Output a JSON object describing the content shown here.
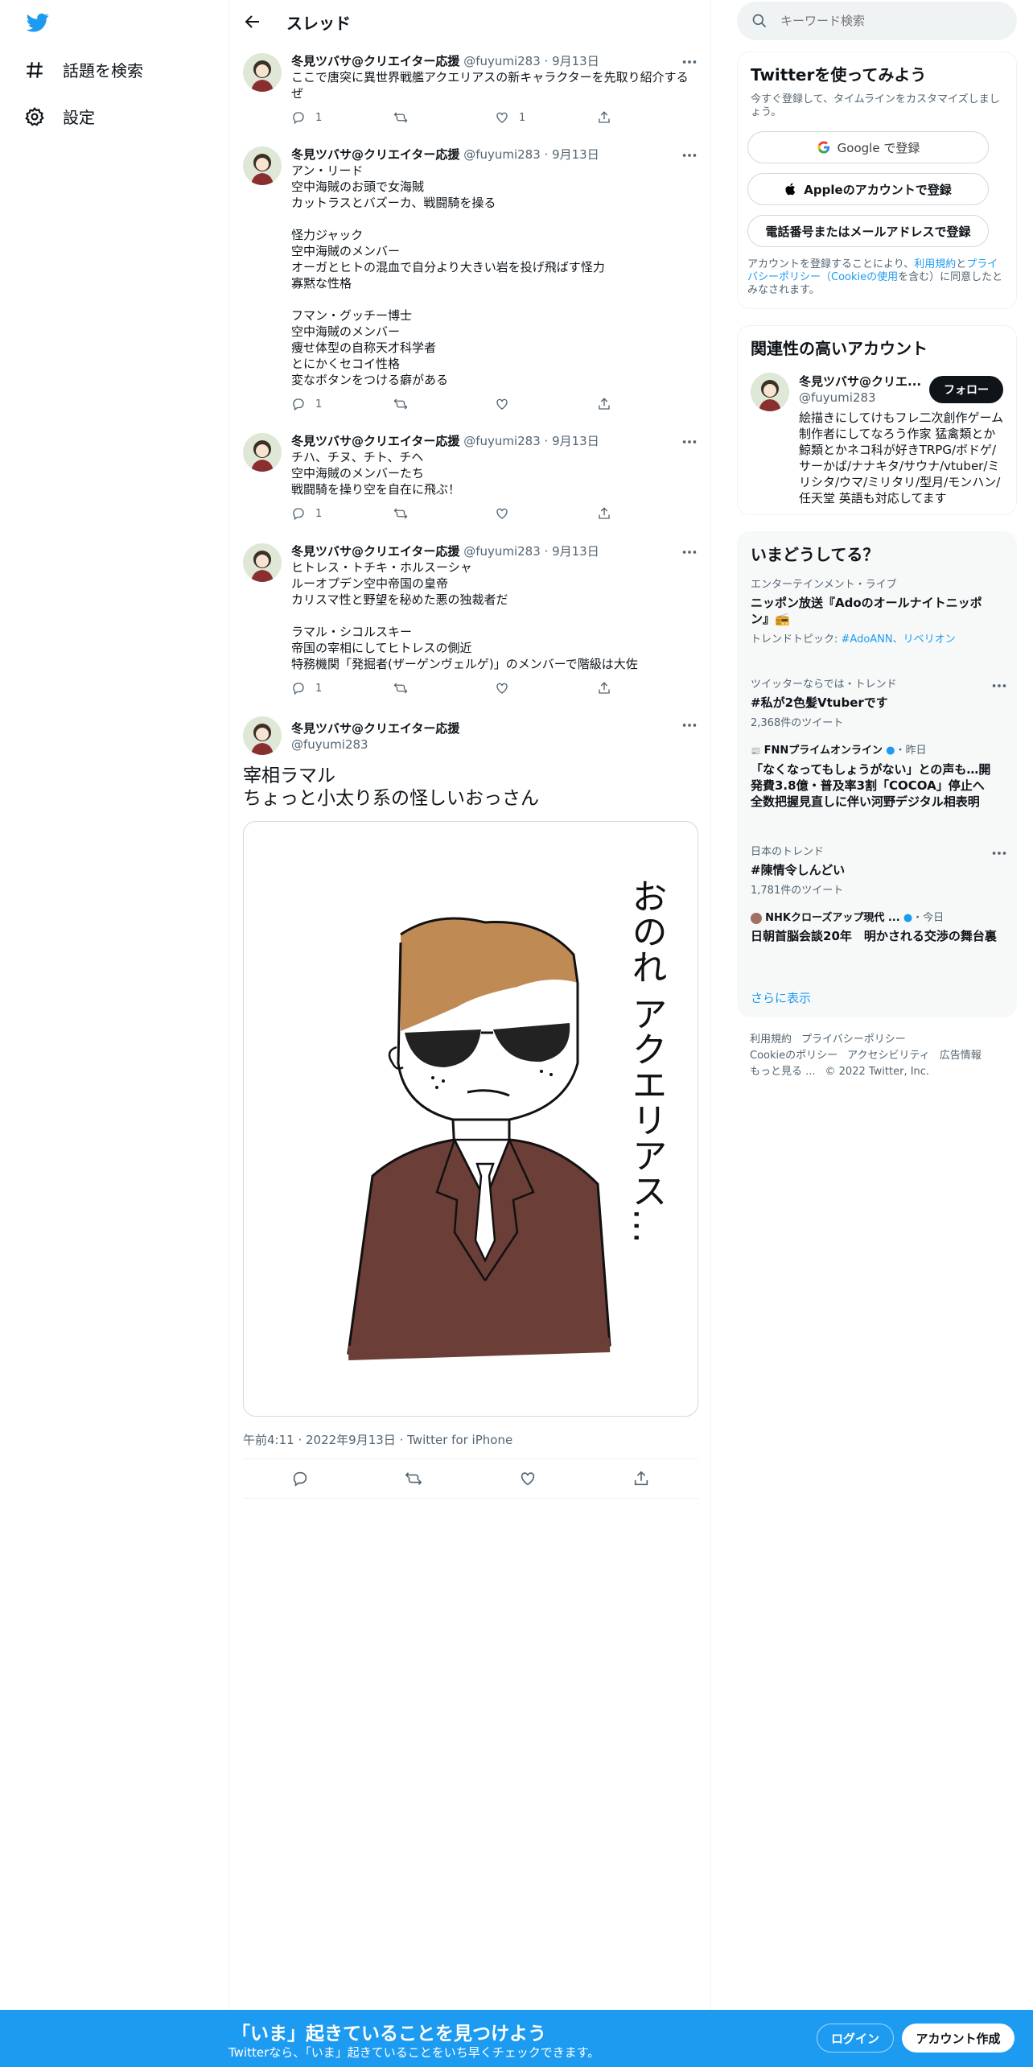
{
  "nav": {
    "explore_label": "話題を検索",
    "settings_label": "設定"
  },
  "header": {
    "title": "スレッド"
  },
  "search": {
    "placeholder": "キーワード検索"
  },
  "author": {
    "name": "冬見ツバサ@クリエイター応援",
    "handle": "@fuyumi283",
    "date": "9月13日"
  },
  "tweets": [
    {
      "text": "ここで唐突に異世界戦艦アクエリアスの新キャラクターを先取り紹介するぜ",
      "replies": "1",
      "retweets": "",
      "likes": "1"
    },
    {
      "text": "アン・リード\n空中海賊のお頭で女海賊\nカットラスとバズーカ、戦闘騎を操る\n\n怪力ジャック\n空中海賊のメンバー\nオーガとヒトの混血で自分より大きい岩を投げ飛ばす怪力\n寡黙な性格\n\nフマン・グッチー博士\n空中海賊のメンバー\n痩せ体型の自称天才科学者\nとにかくセコイ性格\n変なボタンをつける癖がある",
      "replies": "1",
      "retweets": "",
      "likes": ""
    },
    {
      "text": "チハ、チヌ、チト、チヘ\n空中海賊のメンバーたち\n戦闘騎を操り空を自在に飛ぶ！",
      "replies": "1",
      "retweets": "",
      "likes": ""
    },
    {
      "text": "ヒトレス・トチキ・ホルスーシャ\nルーオプデン空中帝国の皇帝\nカリスマ性と野望を秘めた悪の独裁者だ\n\nラマル・シコルスキー\n帝国の宰相にしてヒトレスの側近\n特務機関「発掘者(ザーゲンヴェルゲ)」のメンバーで階級は大佐",
      "replies": "1",
      "retweets": "",
      "likes": ""
    }
  ],
  "focus_tweet": {
    "text": "宰相ラマル\nちょっと小太り系の怪しいおっさん",
    "image_caption": "おのれ アクエリアス…",
    "time": "午前4:11",
    "date": "2022年9月13日",
    "source": "Twitter for iPhone"
  },
  "signup_card": {
    "title": "Twitterを使ってみよう",
    "subtitle": "今すぐ登録して、タイムラインをカスタマイズしましょう。",
    "google_label": "Google で登録",
    "apple_label": "Appleのアカウントで登録",
    "phone_label": "電話番号またはメールアドレスで登録",
    "terms_pre": "アカウントを登録することにより、",
    "terms_link1": "利用規約",
    "terms_and": "と",
    "terms_link2": "プライバシーポリシー（Cookieの使用",
    "terms_post": "を含む）に同意したとみなされます。"
  },
  "related": {
    "title": "関連性の高いアカウント",
    "name": "冬見ツバサ@クリエ...",
    "handle": "@fuyumi283",
    "follow_label": "フォロー",
    "bio": "絵描きにしてけもフレ二次創作ゲーム制作者にしてなろう作家 猛禽類とか鯨類とかネコ科が好きTRPG/ボドゲ/サーかば/ナナキタ/サウナ/vtuber/ミリシタ/ウマ/ミリタリ/型月/モンハン/任天堂 英語も対応してます"
  },
  "trends": {
    "title": "いまどうしてる？",
    "items": [
      {
        "category": "エンターテインメント・ライブ",
        "title": "ニッポン放送『Adoのオールナイトニッポン』📻",
        "sub_pre": "トレンドトピック: ",
        "sub_link": "#AdoANN、リベリオン"
      },
      {
        "category": "ツイッターならでは・トレンド",
        "title": "#私が2色髪Vtuberです",
        "sub": "2,368件のツイート"
      },
      {
        "category": "FNNプライムオンライン",
        "time": "・昨日",
        "title": "「なくなってもしょうがない」との声も…開発費3.8億・普及率3割「COCOA」停止へ 全数把握見直しに伴い河野デジタル相表明"
      },
      {
        "category": "日本のトレンド",
        "title": "#陳情令しんどい",
        "sub": "1,781件のツイート"
      },
      {
        "category": "NHKクローズアップ現代 ...",
        "time": "・今日",
        "title": "日朝首脳会談20年　明かされる交渉の舞台裏"
      }
    ],
    "more_label": "さらに表示"
  },
  "footer": {
    "terms": "利用規約",
    "privacy": "プライバシーポリシー",
    "cookie": "Cookieのポリシー",
    "accessibility": "アクセシビリティ",
    "ads": "広告情報",
    "more": "もっと見る ...",
    "copyright": "© 2022 Twitter, Inc."
  },
  "bottom_bar": {
    "title": "「いま」起きていることを見つけよう",
    "subtitle": "Twitterなら、「いま」起きていることをいち早くチェックできます。",
    "login_label": "ログイン",
    "signup_label": "アカウント作成"
  },
  "colors": {
    "accent": "#1d9bf0",
    "text": "#0f1419",
    "muted": "#536471",
    "jacket": "#6b3e38",
    "hair": "#c08a55"
  }
}
